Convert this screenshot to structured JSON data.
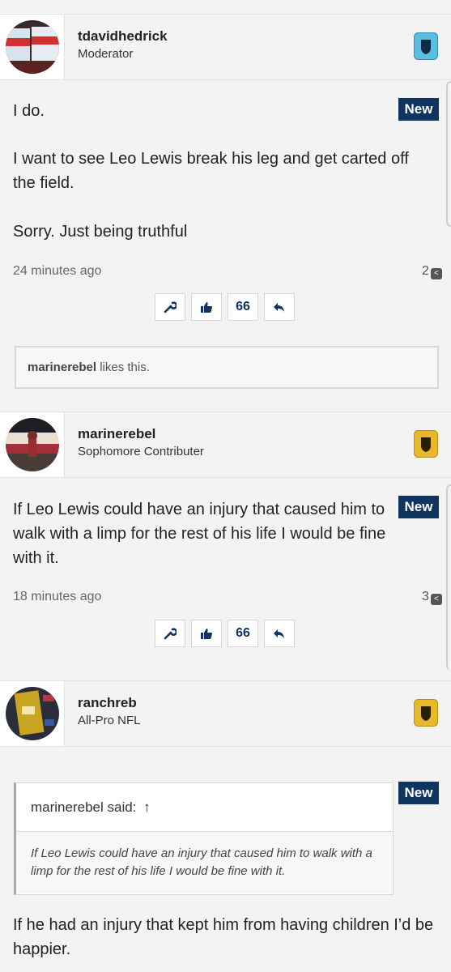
{
  "posts": [
    {
      "username": "tdavidhedrick",
      "user_title": "Moderator",
      "badge": "New",
      "paragraphs": [
        "I do.",
        "I want to see Leo Lewis break his leg and get carted off the field.",
        "Sorry. Just being truthful"
      ],
      "time": "24 minutes ago",
      "share_count": "2",
      "rank_color": "#5bbde0",
      "likes": {
        "user": "marinerebel",
        "text": "likes this."
      }
    },
    {
      "username": "marinerebel",
      "user_title": "Sophomore Contributer",
      "badge": "New",
      "paragraphs": [
        "If Leo Lewis could have an injury that caused him to walk with a limp for the rest of his life I would be fine with it."
      ],
      "time": "18 minutes ago",
      "share_count": "3",
      "rank_color": "#e7b92a"
    },
    {
      "username": "ranchreb",
      "user_title": "All-Pro NFL",
      "badge": "New",
      "rank_color": "#e7b92a",
      "quote": {
        "header": "marinerebel said:",
        "arrow": "↑",
        "text": "If Leo Lewis could have an injury that caused him to walk with a limp for the rest of his life I would be fine with it."
      },
      "paragraphs": [
        "If he had an injury that kept him from having children I’d be happier."
      ]
    }
  ],
  "actions": [
    "wrench-icon",
    "thumbs-up-icon",
    "quote-icon",
    "reply-icon"
  ],
  "colors": {
    "accent": "#0f3460",
    "background": "#f3f3f3"
  }
}
